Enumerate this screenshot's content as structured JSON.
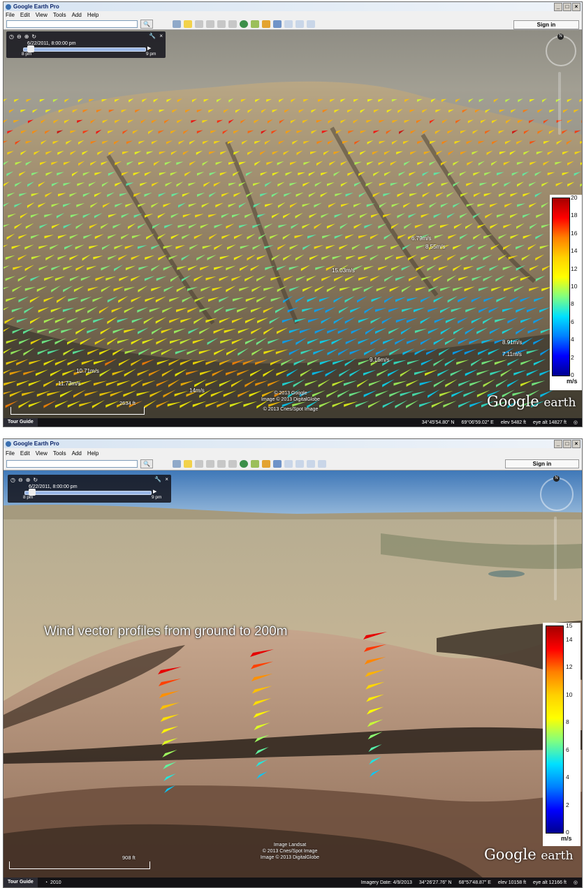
{
  "windows": [
    {
      "id": "win1",
      "title": "Google Earth Pro",
      "menu": [
        "File",
        "Edit",
        "View",
        "Tools",
        "Add",
        "Help"
      ],
      "sign_in": "Sign in",
      "time_slider": {
        "date": "6/22/2011, 8:00:00 pm",
        "start": "8 pm",
        "end": "9 pm",
        "position": 0.03
      },
      "legend": {
        "ticks": [
          "20",
          "18",
          "16",
          "14",
          "12",
          "10",
          "8",
          "6",
          "4",
          "2",
          "0"
        ],
        "unit": "m/s"
      },
      "labels": [
        "15.03m/s",
        "8.91m/s",
        "7.11m/s",
        "9.16m/s",
        "10.71m/s",
        "11.73m/s",
        "14m/s",
        "6.79m/s",
        "8.55m/s"
      ],
      "credits": [
        "© 2013 Google",
        "Image © 2013 DigitalGlobe",
        "© 2013 Cnes/Spot Image"
      ],
      "logo": {
        "word1": "Google",
        "word2": "earth"
      },
      "scale": "2634 ft",
      "status": {
        "tour_guide": "Tour Guide",
        "lat": "34°45'54.80\" N",
        "lon": "69°06'59.02\" E",
        "elev": "elev 5482 ft",
        "eye": "eye alt 14827 ft"
      }
    },
    {
      "id": "win2",
      "title": "Google Earth Pro",
      "menu": [
        "File",
        "Edit",
        "View",
        "Tools",
        "Add",
        "Help"
      ],
      "sign_in": "Sign in",
      "time_slider": {
        "date": "6/22/2011, 8:00:00 pm",
        "start": "8 pm",
        "end": "9 pm",
        "position": 0.03
      },
      "headline": "Wind vector profiles from ground to 200m",
      "legend": {
        "ticks": [
          "15",
          "14",
          "12",
          "10",
          "8",
          "6",
          "4",
          "2",
          "0"
        ],
        "unit": "m/s"
      },
      "credits": [
        "Image Landsat",
        "© 2013 Cnes/Spot Image",
        "Image © 2013 DigitalGlobe"
      ],
      "logo": {
        "word1": "Google",
        "word2": "earth"
      },
      "scale": "908 ft",
      "status": {
        "tour_guide": "Tour Guide",
        "year": "2010",
        "imagery_date": "Imagery Date: 4/9/2013",
        "lat": "34°26'27.76\" N",
        "lon": "68°57'48.87\" E",
        "elev": "elev 10158 ft",
        "eye": "eye alt 12166 ft"
      }
    }
  ]
}
